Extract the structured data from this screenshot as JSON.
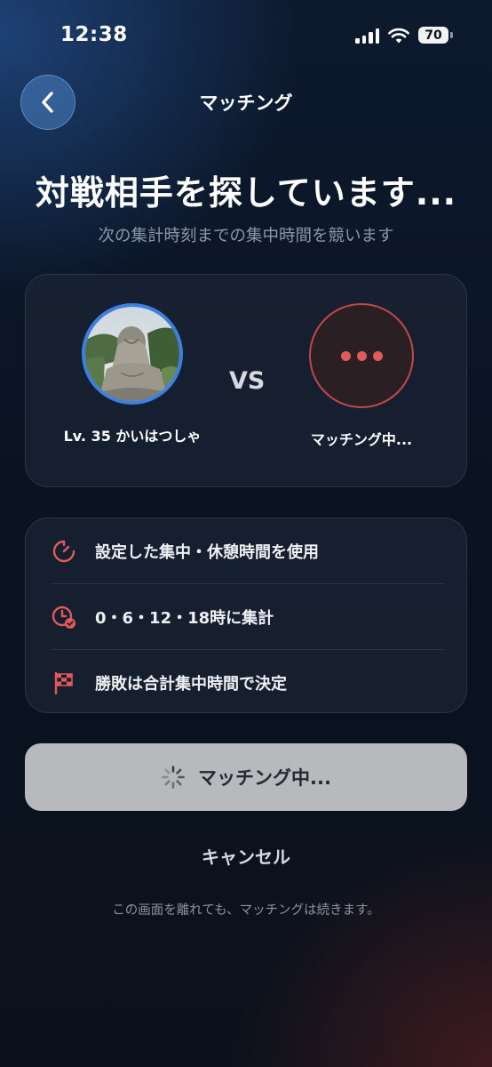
{
  "status_bar": {
    "time": "12:38",
    "battery": "70"
  },
  "nav": {
    "title": "マッチング"
  },
  "header": {
    "title": "対戦相手を探しています...",
    "subtitle": "次の集計時刻までの集中時間を競います"
  },
  "versus": {
    "me": {
      "name": "Lv. 35 かいはつしゃ",
      "avatar": "statue-photo"
    },
    "vs_label": "VS",
    "opponent": {
      "name": "マッチング中...",
      "avatar": "ellipsis-icon"
    }
  },
  "rules": [
    {
      "icon": "timer-icon",
      "text": "設定した集中・休憩時間を使用"
    },
    {
      "icon": "clock-check-icon",
      "text": "0・6・12・18時に集計"
    },
    {
      "icon": "checkered-flag-icon",
      "text": "勝敗は合計集中時間で決定"
    }
  ],
  "match_button": {
    "label": "マッチング中..."
  },
  "cancel": {
    "label": "キャンセル"
  },
  "footnote": "この画面を離れても、マッチングは続きます。",
  "colors": {
    "accent_red": "#e05a5a",
    "avatar_ring": "#3b7fe0",
    "button_bg": "#b8b9bd"
  }
}
